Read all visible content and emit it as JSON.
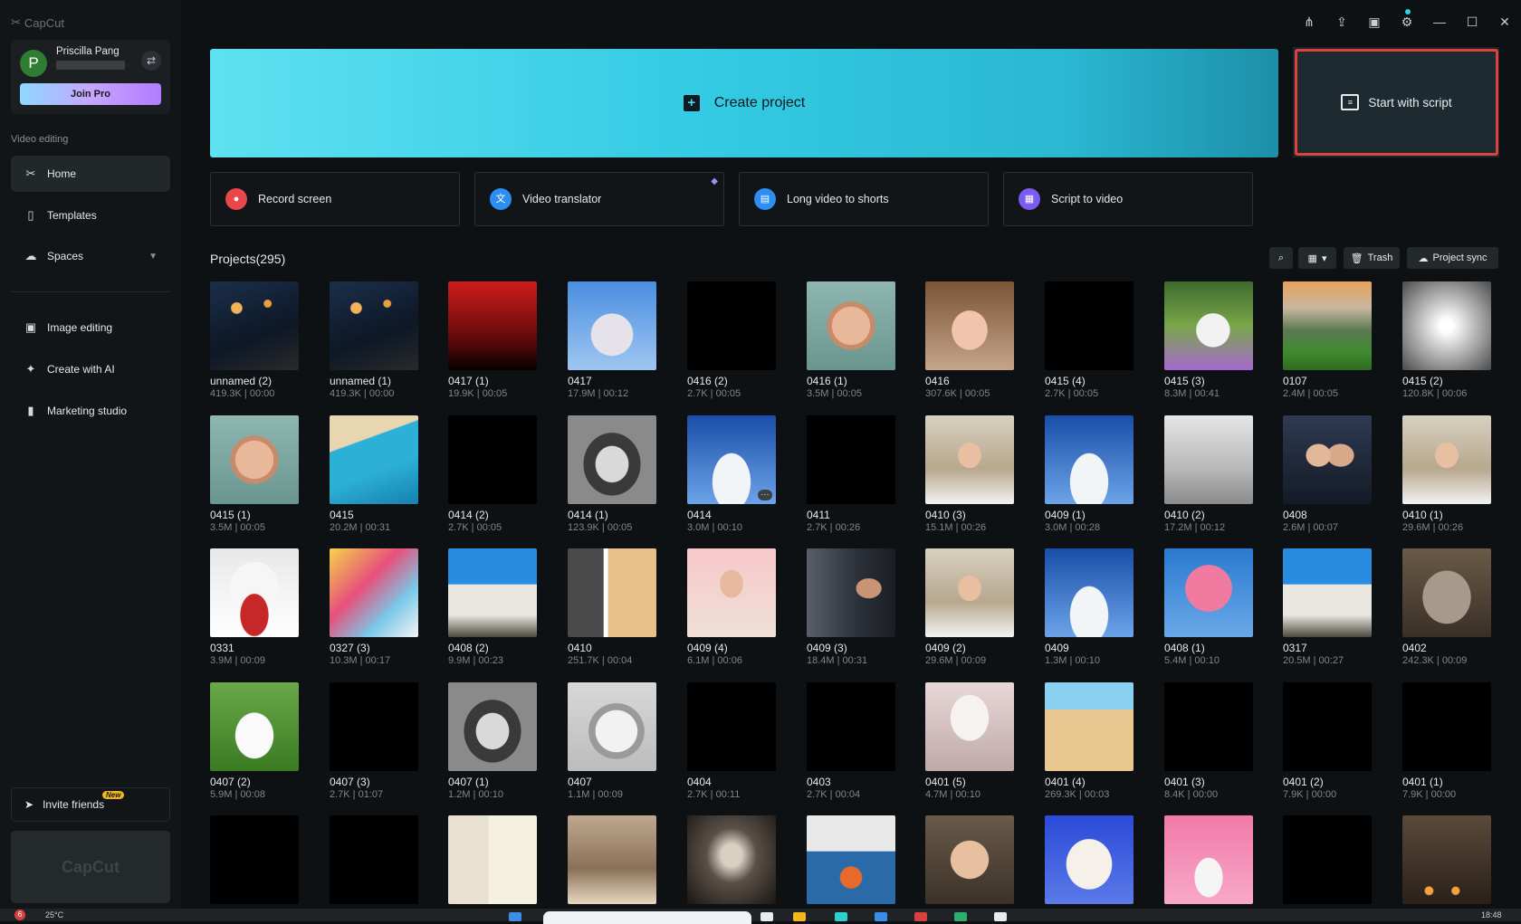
{
  "app": {
    "logo_text": "CapCut"
  },
  "user": {
    "name": "Priscilla Pang",
    "initial": "P",
    "join_pro": "Join Pro"
  },
  "sidebar": {
    "section_video": "Video editing",
    "items": [
      {
        "label": "Home",
        "icon": "scissors-icon"
      },
      {
        "label": "Templates",
        "icon": "templates-icon"
      },
      {
        "label": "Spaces",
        "icon": "cloud-icon"
      },
      {
        "label": "Image editing",
        "icon": "image-icon"
      },
      {
        "label": "Create with AI",
        "icon": "sparkle-icon"
      },
      {
        "label": "Marketing studio",
        "icon": "marketing-icon"
      }
    ],
    "invite": "Invite friends",
    "new_badge": "New",
    "promo_logo": "CapCut"
  },
  "hero": {
    "create_project": "Create project",
    "start_with_script": "Start with script"
  },
  "tools": [
    {
      "label": "Record screen",
      "icon": "record-icon",
      "color": "#e8474c"
    },
    {
      "label": "Video translator",
      "icon": "translate-icon",
      "color": "#2e8df0"
    },
    {
      "label": "Long video to shorts",
      "icon": "shorts-icon",
      "color": "#2e8df0"
    },
    {
      "label": "Script to video",
      "icon": "script-icon",
      "color": "#7b5cf0"
    }
  ],
  "projects": {
    "title": "Projects(295)",
    "trash": "Trash",
    "sync": "Project sync",
    "items": [
      {
        "name": "unnamed (2)",
        "meta": "419.3K | 00:00",
        "thumb": "boy-cat-night"
      },
      {
        "name": "unnamed (1)",
        "meta": "419.3K | 00:00",
        "thumb": "boy-cat-night"
      },
      {
        "name": "0417 (1)",
        "meta": "19.9K | 00:05",
        "thumb": "red-gradient"
      },
      {
        "name": "0417",
        "meta": "17.9M | 00:12",
        "thumb": "blossom-sky"
      },
      {
        "name": "0416 (2)",
        "meta": "2.7K | 00:05",
        "thumb": "black"
      },
      {
        "name": "0416 (1)",
        "meta": "3.5M | 00:05",
        "thumb": "boy-portrait"
      },
      {
        "name": "0416",
        "meta": "307.6K | 00:05",
        "thumb": "girl-portrait"
      },
      {
        "name": "0415 (4)",
        "meta": "2.7K | 00:05",
        "thumb": "black"
      },
      {
        "name": "0415 (3)",
        "meta": "8.3M | 00:41",
        "thumb": "white-cat-garden"
      },
      {
        "name": "0107",
        "meta": "2.4M | 00:05",
        "thumb": "mountain-valley"
      },
      {
        "name": "0415 (2)",
        "meta": "120.8K | 00:06",
        "thumb": "grey-radial"
      },
      {
        "name": "0415 (1)",
        "meta": "3.5M | 00:05",
        "thumb": "boy-portrait"
      },
      {
        "name": "0415",
        "meta": "20.2M | 00:31",
        "thumb": "beach"
      },
      {
        "name": "0414 (2)",
        "meta": "2.7K | 00:05",
        "thumb": "black"
      },
      {
        "name": "0414 (1)",
        "meta": "123.9K | 00:05",
        "thumb": "bw-portrait"
      },
      {
        "name": "0414",
        "meta": "3.0M | 00:10",
        "thumb": "sky-clouds",
        "more": true
      },
      {
        "name": "0411",
        "meta": "2.7K | 00:26",
        "thumb": "black"
      },
      {
        "name": "0410 (3)",
        "meta": "15.1M | 00:26",
        "thumb": "girl-reading"
      },
      {
        "name": "0409 (1)",
        "meta": "3.0M | 00:28",
        "thumb": "sky-clouds"
      },
      {
        "name": "0410 (2)",
        "meta": "17.2M | 00:12",
        "thumb": "couple-bed"
      },
      {
        "name": "0408",
        "meta": "2.6M | 00:07",
        "thumb": "couple-dark"
      },
      {
        "name": "0410 (1)",
        "meta": "29.6M | 00:26",
        "thumb": "girl-reading"
      },
      {
        "name": "0331",
        "meta": "3.9M | 00:09",
        "thumb": "cat-bandana"
      },
      {
        "name": "0327 (3)",
        "meta": "10.3M | 00:17",
        "thumb": "party-kids"
      },
      {
        "name": "0408 (2)",
        "meta": "9.9M | 00:23",
        "thumb": "van-sky"
      },
      {
        "name": "0410",
        "meta": "251.7K | 00:04",
        "thumb": "bw-color-split"
      },
      {
        "name": "0409 (4)",
        "meta": "6.1M | 00:06",
        "thumb": "girl-pink"
      },
      {
        "name": "0409 (3)",
        "meta": "18.4M | 00:31",
        "thumb": "man-speaking"
      },
      {
        "name": "0409 (2)",
        "meta": "29.6M | 00:09",
        "thumb": "girl-reading"
      },
      {
        "name": "0409",
        "meta": "1.3M | 00:10",
        "thumb": "sky-clouds"
      },
      {
        "name": "0408 (1)",
        "meta": "5.4M | 00:10",
        "thumb": "pink-blossom"
      },
      {
        "name": "0317",
        "meta": "20.5M | 00:27",
        "thumb": "van-sky"
      },
      {
        "name": "0402",
        "meta": "242.3K | 00:09",
        "thumb": "grey-cat"
      },
      {
        "name": "0407 (2)",
        "meta": "5.9M | 00:08",
        "thumb": "white-cat-grass"
      },
      {
        "name": "0407 (3)",
        "meta": "2.7K | 01:07",
        "thumb": "black"
      },
      {
        "name": "0407 (1)",
        "meta": "1.2M | 00:10",
        "thumb": "bw-portrait"
      },
      {
        "name": "0407",
        "meta": "1.1M | 00:09",
        "thumb": "grey-white-cat"
      },
      {
        "name": "0404",
        "meta": "2.7K | 00:11",
        "thumb": "black"
      },
      {
        "name": "0403",
        "meta": "2.7K | 00:04",
        "thumb": "black"
      },
      {
        "name": "0401 (5)",
        "meta": "4.7M | 00:10",
        "thumb": "wedding"
      },
      {
        "name": "0401 (4)",
        "meta": "269.3K | 00:03",
        "thumb": "anime-beach"
      },
      {
        "name": "0401 (3)",
        "meta": "8.4K | 00:00",
        "thumb": "black"
      },
      {
        "name": "0401 (2)",
        "meta": "7.9K | 00:00",
        "thumb": "black"
      },
      {
        "name": "0401 (1)",
        "meta": "7.9K | 00:00",
        "thumb": "black"
      },
      {
        "name": "",
        "meta": "",
        "thumb": "black"
      },
      {
        "name": "",
        "meta": "",
        "thumb": "black"
      },
      {
        "name": "",
        "meta": "",
        "thumb": "woman-chalk"
      },
      {
        "name": "",
        "meta": "",
        "thumb": "cooking"
      },
      {
        "name": "",
        "meta": "",
        "thumb": "dark-room"
      },
      {
        "name": "",
        "meta": "",
        "thumb": "basketball"
      },
      {
        "name": "",
        "meta": "",
        "thumb": "woman-face"
      },
      {
        "name": "",
        "meta": "",
        "thumb": "white-cat-blue"
      },
      {
        "name": "",
        "meta": "",
        "thumb": "girl-pink-bg"
      },
      {
        "name": "",
        "meta": "",
        "thumb": "black"
      },
      {
        "name": "",
        "meta": "",
        "thumb": "funeral-box"
      }
    ]
  },
  "taskbar": {
    "weather": "25°C",
    "time": "18:48",
    "notif_count": "6"
  }
}
